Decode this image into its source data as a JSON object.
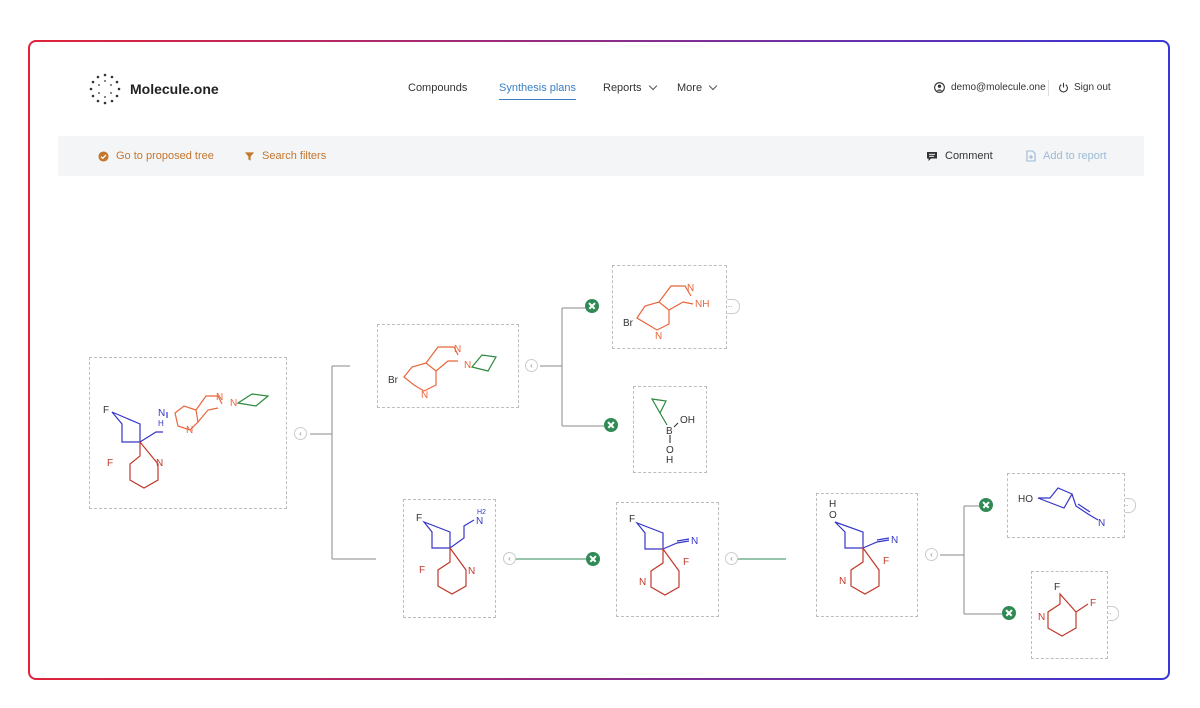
{
  "app": {
    "name": "Molecule.one"
  },
  "nav": {
    "items": [
      {
        "label": "Compounds",
        "active": false
      },
      {
        "label": "Synthesis plans",
        "active": true
      },
      {
        "label": "Reports",
        "dropdown": true
      },
      {
        "label": "More",
        "dropdown": true
      }
    ]
  },
  "user": {
    "email": "demo@molecule.one",
    "sign_out": "Sign out"
  },
  "toolbar": {
    "proposed_tree": "Go to proposed tree",
    "search_filters": "Search filters",
    "comment": "Comment",
    "add_to_report": "Add to report"
  },
  "molecules": {
    "target": {
      "atoms": [
        "F",
        "N",
        "H",
        "N",
        "N",
        "N",
        "F",
        "N"
      ]
    },
    "bromo_cyclopropyl": {
      "atoms": [
        "Br",
        "N",
        "N",
        "N"
      ]
    },
    "bromo_indazole": {
      "atoms": [
        "Br",
        "N",
        "N",
        "NH"
      ]
    },
    "boronic_acid": {
      "atoms": [
        "OH",
        "B",
        "O",
        "H"
      ]
    },
    "amine": {
      "atoms": [
        "F",
        "H2",
        "N",
        "F",
        "N"
      ]
    },
    "nitrile": {
      "atoms": [
        "F",
        "N",
        "F",
        "N"
      ]
    },
    "hydroxy_nitrile": {
      "atoms": [
        "H",
        "O",
        "N",
        "F",
        "N"
      ]
    },
    "hydroxy_cyclobutane_nitrile": {
      "atoms": [
        "HO",
        "N"
      ]
    },
    "difluoropyridine": {
      "atoms": [
        "F",
        "F",
        "N"
      ]
    }
  },
  "controls": {
    "collapse": "‹",
    "more": "..."
  },
  "colors": {
    "orange": "#e8663b",
    "blue": "#3636c8",
    "green": "#2b8a3e",
    "red": "#c0392b",
    "reaction": "#2f8a55",
    "accent": "#3a7fc2",
    "toolbar_orange": "#c4762d"
  },
  "icons": [
    "logo-dots-icon",
    "user-circle-icon",
    "power-icon",
    "check-circle-icon",
    "filter-icon",
    "comment-icon",
    "add-report-icon",
    "reaction-icon"
  ]
}
